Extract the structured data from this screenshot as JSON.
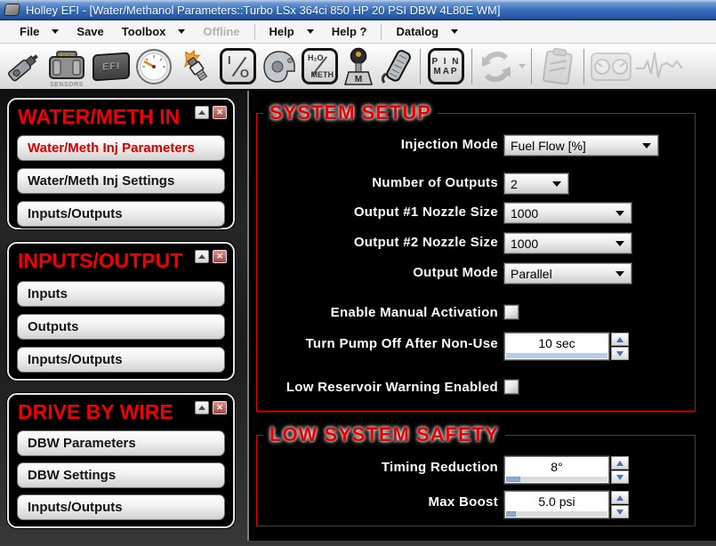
{
  "window": {
    "title": "Holley EFI - [Water/Methanol Parameters::Turbo LSx 364ci 850 HP 20 PSI DBW 4L80E WM]"
  },
  "menu": {
    "items": [
      {
        "label": "File",
        "arrow": true
      },
      {
        "label": "Save",
        "arrow": false
      },
      {
        "label": "Toolbox",
        "arrow": true
      },
      {
        "label": "Offline",
        "arrow": false,
        "disabled": true
      },
      {
        "label": "Help",
        "arrow": true
      },
      {
        "label": "Help ?",
        "arrow": false
      },
      {
        "label": "Datalog",
        "arrow": true
      }
    ]
  },
  "toolbar": {
    "labels": {
      "sensors": "SENSORS",
      "efi": "EFI",
      "io_i": "I",
      "io_o": "O",
      "h2o": "H₂O",
      "meth": "METH",
      "shifter_m": "M",
      "pin": "P I N",
      "map": "MAP"
    }
  },
  "sidebar": {
    "panels": [
      {
        "title": "WATER/METH IN",
        "buttons": [
          {
            "label": "Water/Meth Inj Parameters",
            "active": true
          },
          {
            "label": "Water/Meth Inj Settings",
            "active": false
          },
          {
            "label": "Inputs/Outputs",
            "active": false
          }
        ]
      },
      {
        "title": "INPUTS/OUTPUT",
        "buttons": [
          {
            "label": "Inputs",
            "active": false
          },
          {
            "label": "Outputs",
            "active": false
          },
          {
            "label": "Inputs/Outputs",
            "active": false
          }
        ]
      },
      {
        "title": "DRIVE BY WIRE",
        "buttons": [
          {
            "label": "DBW Parameters",
            "active": false
          },
          {
            "label": "DBW Settings",
            "active": false
          },
          {
            "label": "Inputs/Outputs",
            "active": false
          }
        ]
      }
    ]
  },
  "main": {
    "sections": [
      {
        "title": "SYSTEM SETUP",
        "rows": [
          {
            "type": "dropdown",
            "label": "Injection Mode",
            "value": "Fuel Flow [%]"
          },
          {
            "type": "dropdown",
            "label": "Number of Outputs",
            "value": "2"
          },
          {
            "type": "dropdown",
            "label": "Output #1 Nozzle Size",
            "value": "1000"
          },
          {
            "type": "dropdown",
            "label": "Output #2 Nozzle Size",
            "value": "1000"
          },
          {
            "type": "dropdown",
            "label": "Output Mode",
            "value": "Parallel"
          },
          {
            "type": "checkbox",
            "label": "Enable Manual Activation",
            "checked": false
          },
          {
            "type": "spinner",
            "label": "Turn Pump Off After Non-Use",
            "value": "10 sec"
          },
          {
            "type": "checkbox",
            "label": "Low Reservoir Warning Enabled",
            "checked": false
          }
        ]
      },
      {
        "title": "LOW SYSTEM SAFETY",
        "rows": [
          {
            "type": "spinner",
            "label": "Timing Reduction",
            "value": "8°"
          },
          {
            "type": "spinner",
            "label": "Max Boost",
            "value": "5.0 psi"
          }
        ]
      }
    ]
  },
  "colors": {
    "accent_red": "#e00000",
    "titlebar_blue": "#3a6fbb",
    "spinner_thumb_blue": "#8fabd4"
  }
}
